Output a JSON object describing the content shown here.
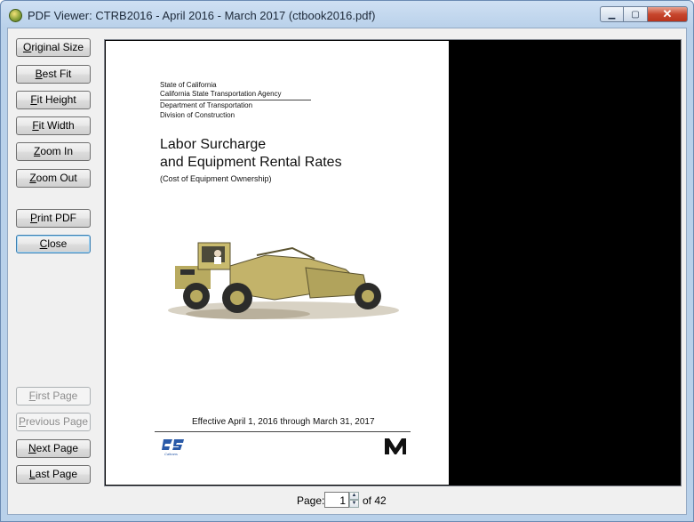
{
  "window": {
    "title": "PDF Viewer: CTRB2016 - April 2016 - March 2017 (ctbook2016.pdf)",
    "minimize_glyph": "▁",
    "maximize_glyph": "▢",
    "close_glyph": "✕"
  },
  "sidebar": {
    "original_size": {
      "key": "O",
      "rest": "riginal Size"
    },
    "best_fit": {
      "key": "B",
      "rest": "est Fit"
    },
    "fit_height": {
      "key": "F",
      "rest": "it Height"
    },
    "fit_width": {
      "key": "F",
      "rest": "it Width"
    },
    "zoom_in": {
      "key": "Z",
      "rest": "oom In"
    },
    "zoom_out": {
      "key": "Z",
      "rest": "oom Out"
    },
    "print_pdf": {
      "key": "P",
      "rest": "rint PDF"
    },
    "close": {
      "key": "C",
      "rest": "lose"
    },
    "first_page": {
      "key": "F",
      "rest": "irst Page"
    },
    "previous_page": {
      "key": "P",
      "rest": "revious Page"
    },
    "next_page": {
      "key": "N",
      "rest": "ext Page"
    },
    "last_page": {
      "key": "L",
      "rest": "ast Page"
    }
  },
  "document": {
    "org_lines": [
      "State of California",
      "California State Transportation Agency",
      "Department of Transportation",
      "Division of Construction"
    ],
    "title_line1": "Labor Surcharge",
    "title_line2": "and Equipment Rental Rates",
    "subtitle": "(Cost of Equipment Ownership)",
    "effective": "Effective April 1, 2016 through March 31, 2017",
    "caltrans_logo_text": "Caltrans"
  },
  "pager": {
    "label": "Page:",
    "current_page": "1",
    "of_text": "of 42"
  }
}
